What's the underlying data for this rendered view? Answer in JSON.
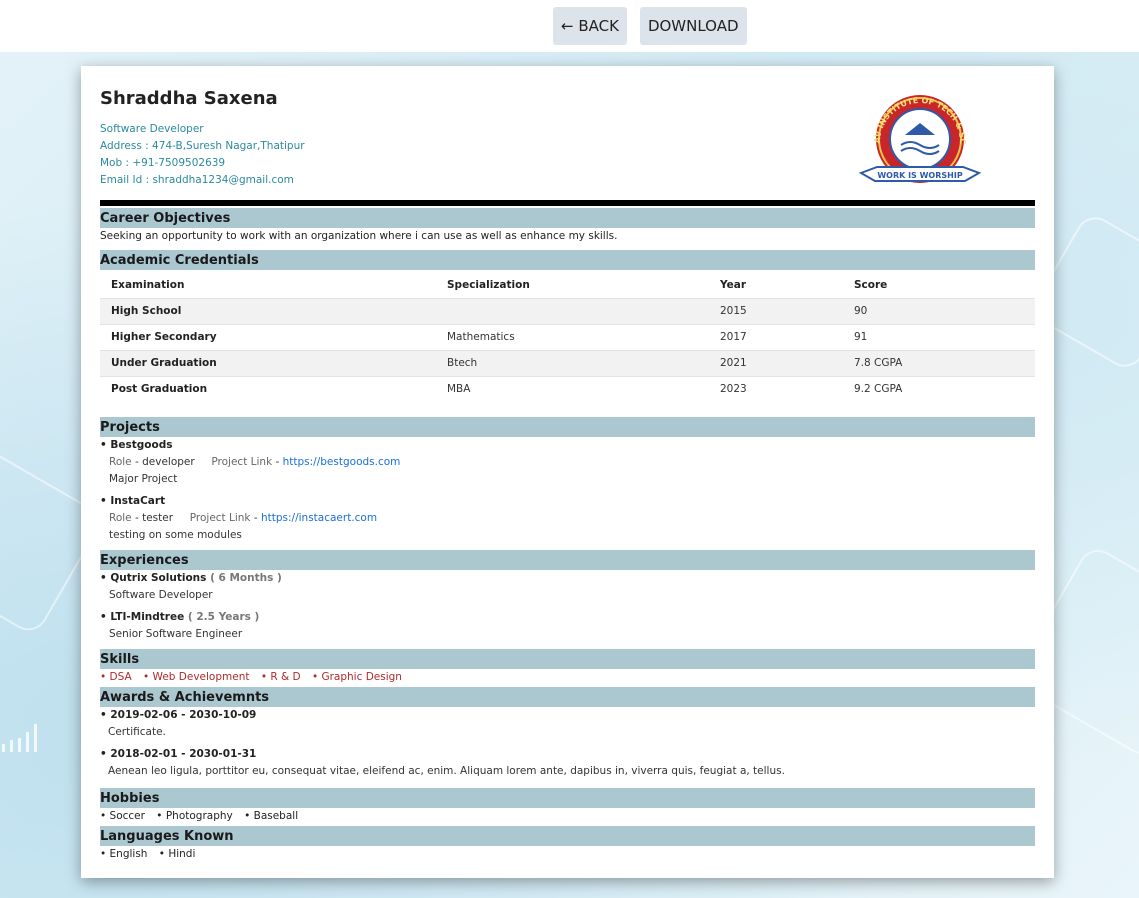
{
  "toolbar": {
    "back_label": "← BACK",
    "download_label": "DOWNLOAD"
  },
  "profile": {
    "name": "Shraddha Saxena",
    "title": "Software Developer",
    "address": "Address : 474-B,Suresh Nagar,Thatipur",
    "mobile": "Mob : +91-7509502639",
    "email": "Email Id : shraddha1234@gmail.com",
    "logo_text": "MADHAV INSTITUTE OF TECH & SCIENCE",
    "logo_motto": "WORK IS WORSHIP"
  },
  "career": {
    "heading": "Career Objectives",
    "text": "Seeking an opportunity to work with an organization where i can use as well as enhance my skills."
  },
  "academic": {
    "heading": "Academic Credentials",
    "columns": [
      "Examination",
      "Specialization",
      "Year",
      "Score"
    ],
    "rows": [
      [
        "High School",
        "",
        "2015",
        "90"
      ],
      [
        "Higher Secondary",
        "Mathematics",
        "2017",
        "91"
      ],
      [
        "Under Graduation",
        "Btech",
        "2021",
        "7.8 CGPA"
      ],
      [
        "Post Graduation",
        "MBA",
        "2023",
        "9.2 CGPA"
      ]
    ]
  },
  "projects": {
    "heading": "Projects",
    "items": [
      {
        "name": "• Bestgoods",
        "role_label": "Role",
        "role": " - developer",
        "link_label": "Project Link",
        "link": "https://bestgoods.com",
        "desc": "Major Project"
      },
      {
        "name": "• InstaCart",
        "role_label": "Role",
        "role": " - tester",
        "link_label": "Project Link",
        "link": "https://instacaert.com",
        "desc": "testing on some modules"
      }
    ]
  },
  "experiences": {
    "heading": "Experiences",
    "items": [
      {
        "company": "• Qutrix Solutions",
        "duration": "( 6 Months )",
        "role": "Software Developer"
      },
      {
        "company": "• LTI-Mindtree",
        "duration": "( 2.5 Years )",
        "role": "Senior Software Engineer"
      }
    ]
  },
  "skills": {
    "heading": "Skills",
    "items": [
      "• DSA",
      "• Web Development",
      "• R & D",
      "• Graphic Design"
    ]
  },
  "awards": {
    "heading": "Awards & Achievemnts",
    "items": [
      {
        "dates": "• 2019-02-06 - 2030-10-09",
        "desc": "Certificate."
      },
      {
        "dates": "• 2018-02-01 - 2030-01-31",
        "desc": "Aenean leo ligula, porttitor eu, consequat vitae, eleifend ac, enim. Aliquam lorem ante, dapibus in, viverra quis, feugiat a, tellus."
      }
    ]
  },
  "hobbies": {
    "heading": "Hobbies",
    "items": [
      "• Soccer",
      "• Photography",
      "• Baseball"
    ]
  },
  "languages": {
    "heading": "Languages Known",
    "items": [
      "• English",
      "• Hindi"
    ]
  },
  "colors": {
    "section_band": "#abc8d1",
    "contact_text": "#2b8a9e",
    "link": "#1a6fd6",
    "skill": "#b02a2a",
    "toolbar_button": "#dde3ea"
  }
}
